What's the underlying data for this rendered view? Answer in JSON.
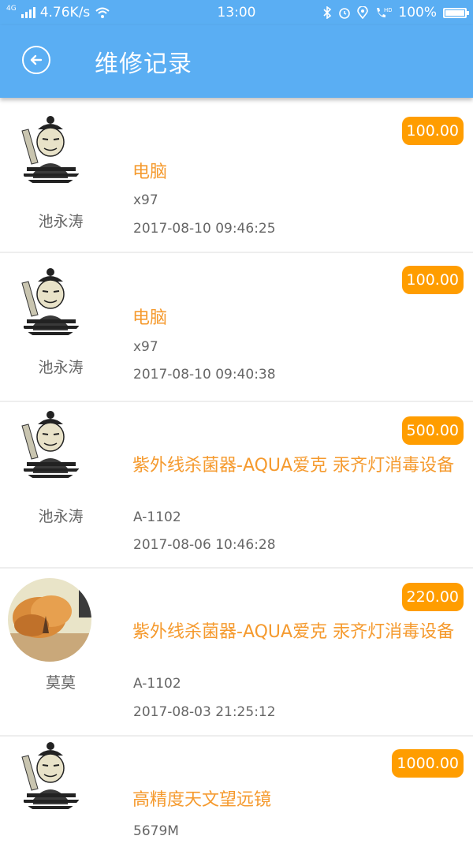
{
  "status_bar": {
    "network": "4G",
    "speed": "4.76K/s",
    "time": "13:00",
    "battery": "100%",
    "battery_level": 1.0,
    "icons": [
      "signal-icon",
      "wifi-icon",
      "bluetooth-icon",
      "alarm-icon",
      "location-icon",
      "hd-call-icon",
      "battery-icon"
    ]
  },
  "header": {
    "title": "维修记录",
    "back_icon": "back-arrow-icon"
  },
  "colors": {
    "primary": "#5aaef3",
    "accent": "#ff9d00",
    "product_text": "#f59a2e",
    "meta_text": "#666666"
  },
  "records": [
    {
      "user": "池永涛",
      "avatar": "meme-avatar",
      "price": "100.00",
      "product": "电脑",
      "model": "x97",
      "date": "2017-08-10 09:46:25"
    },
    {
      "user": "池永涛",
      "avatar": "meme-avatar",
      "price": "100.00",
      "product": "电脑",
      "model": "x97",
      "date": "2017-08-10 09:40:38"
    },
    {
      "user": "池永涛",
      "avatar": "meme-avatar",
      "price": "500.00",
      "product": "紫外线杀菌器-AQUA爱克 汞齐灯消毒设备",
      "model": "A-1102",
      "date": "2017-08-06 10:46:28"
    },
    {
      "user": "莫莫",
      "avatar": "autumn-tree-photo",
      "price": "220.00",
      "product": "紫外线杀菌器-AQUA爱克 汞齐灯消毒设备",
      "model": "A-1102",
      "date": "2017-08-03 21:25:12"
    },
    {
      "user": "",
      "avatar": "meme-avatar",
      "price": "1000.00",
      "product": "高精度天文望远镜",
      "model": "5679M",
      "date": ""
    }
  ]
}
